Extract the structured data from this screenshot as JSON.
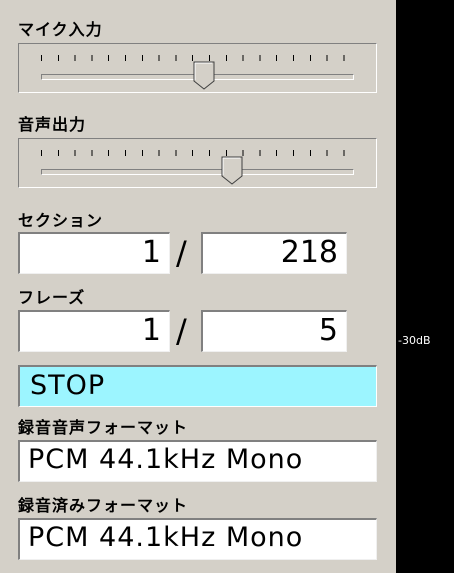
{
  "mic_input": {
    "label": "マイク入力",
    "level": 0.52
  },
  "audio_output": {
    "label": "音声出力",
    "level": 0.61
  },
  "section": {
    "label": "セクション",
    "current": "1",
    "separator": "/",
    "total": "218"
  },
  "phrase": {
    "label": "フレーズ",
    "current": "1",
    "separator": "/",
    "total": "5"
  },
  "status": {
    "text": "STOP",
    "color": "#9cf5ff"
  },
  "record_format": {
    "label": "録音音声フォーマット",
    "value": "PCM 44.1kHz Mono"
  },
  "recorded_format": {
    "label": "録音済みフォーマット",
    "value": "PCM 44.1kHz Mono"
  },
  "level_meter": {
    "db_label": "-30dB",
    "color": "#000000"
  }
}
